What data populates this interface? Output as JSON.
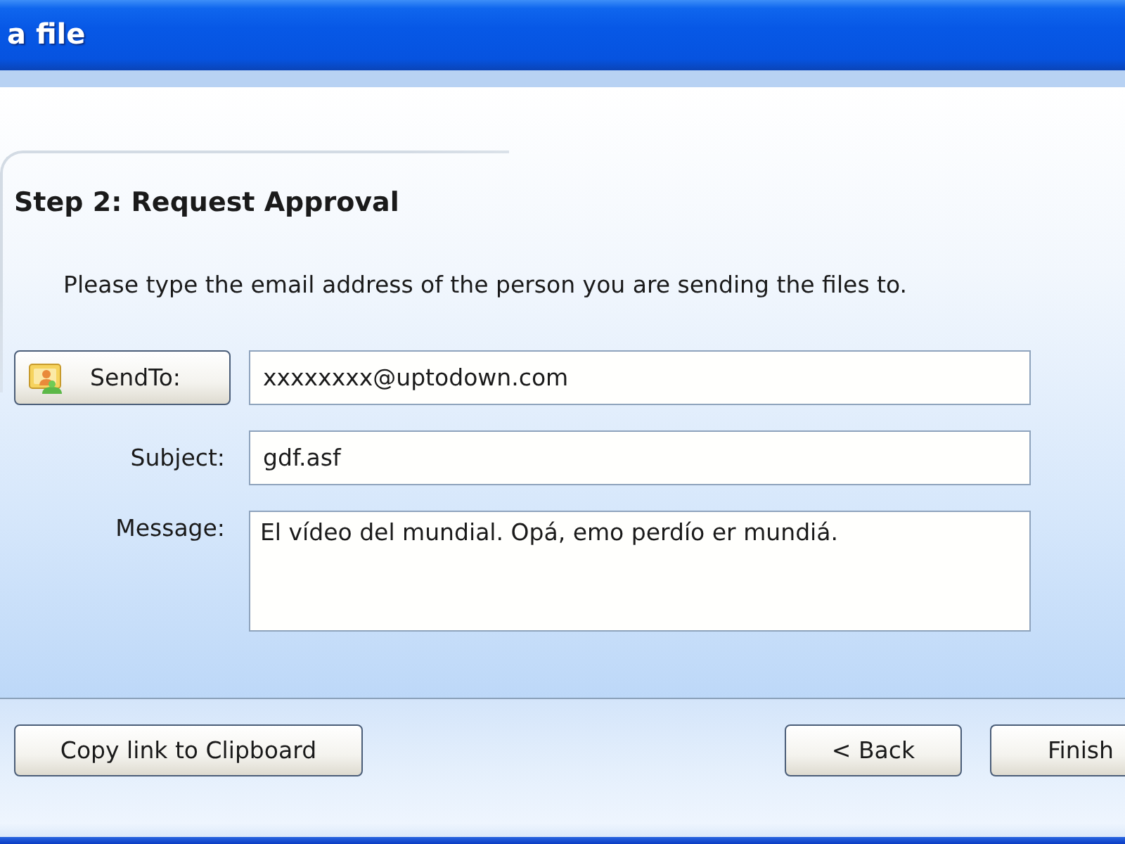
{
  "window": {
    "title": "a file"
  },
  "step": {
    "heading": "Step 2: Request Approval",
    "instruction": "Please type the email address of the person you are sending the files to."
  },
  "form": [
    {
      "kind": "button",
      "label": "SendTo:",
      "value": "xxxxxxxx@uptodown.com"
    },
    {
      "kind": "line",
      "label": "Subject:",
      "value": "gdf.asf"
    },
    {
      "kind": "area",
      "label": "Message:",
      "value": "El vídeo del mundial. Opá, emo perdío er mundiá."
    }
  ],
  "footer": {
    "left_buttons": [
      "Copy link to Clipboard"
    ],
    "right_buttons": [
      "< Back",
      "Finish"
    ]
  }
}
